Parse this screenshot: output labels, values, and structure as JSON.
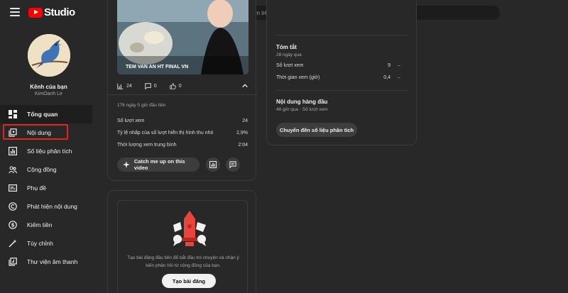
{
  "app": {
    "logo_text": "Studio",
    "brand_color": "#ff0000"
  },
  "search": {
    "placeholder": "Tìm kiếm trên kênh của bạn"
  },
  "channel": {
    "name": "Kênh của bạn",
    "handle": "KimOanh Le"
  },
  "sidebar": {
    "items": [
      {
        "label": "Tổng quan",
        "icon": "dashboard-icon",
        "active": true
      },
      {
        "label": "Nội dung",
        "icon": "content-icon",
        "active": false
      },
      {
        "label": "Số liệu phân tích",
        "icon": "analytics-icon",
        "active": false
      },
      {
        "label": "Cộng đồng",
        "icon": "community-icon",
        "active": false
      },
      {
        "label": "Phụ đề",
        "icon": "subtitles-icon",
        "active": false
      },
      {
        "label": "Phát hiện nội dung",
        "icon": "copyright-icon",
        "active": false
      },
      {
        "label": "Kiếm tiền",
        "icon": "monetization-icon",
        "active": false
      },
      {
        "label": "Tùy chỉnh",
        "icon": "customization-icon",
        "active": false
      },
      {
        "label": "Thư viện âm thanh",
        "icon": "audio-library-icon",
        "active": false
      }
    ],
    "highlight_color": "#e0271c"
  },
  "latest_video": {
    "thumbnail_title": "TEM VAN AN HT FINAL VN",
    "views_count": "24",
    "comments_count": "0",
    "likes_count": "0",
    "first_hours": "176 ngày 5 giờ đầu tiên",
    "metrics": [
      {
        "label": "Số lượt xem",
        "value": "24"
      },
      {
        "label": "Tỷ lệ nhấp của số lượt hiển thị hình thu nhỏ",
        "value": "2,9%"
      },
      {
        "label": "Thời lượng xem trung bình",
        "value": "2:04"
      }
    ],
    "catch_up_label": "Catch me up on this video"
  },
  "community_post": {
    "description": "Tạo bài đăng đầu tiên để bắt đầu trò chuyện và nhận ý kiến phản hồi từ cộng đồng của bạn.",
    "button_label": "Tạo bài đăng"
  },
  "analytics": {
    "summary_title": "Tóm tắt",
    "summary_period": "28 ngày qua",
    "rows": [
      {
        "label": "Số lượt xem",
        "value": "9",
        "delta": "–"
      },
      {
        "label": "Thời gian xem (giờ)",
        "value": "0,4",
        "delta": "–"
      }
    ],
    "top_content_title": "Nội dung hàng đầu",
    "top_content_sub": "48 giờ qua · Số lượt xem",
    "button_label": "Chuyển đến số liệu phân tích"
  }
}
